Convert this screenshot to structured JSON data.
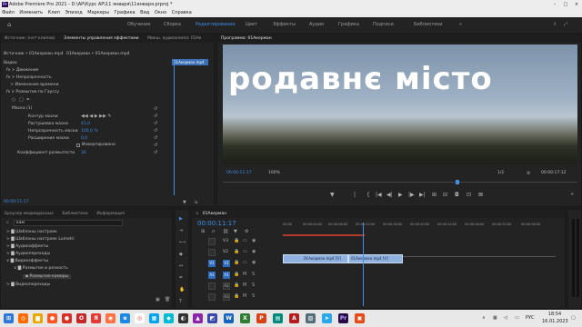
{
  "titlebar": {
    "title": "Adobe Premiere Pro 2021 - D:\\AP\\Курс AP\\11 января\\11января.prproj *",
    "logo": "Pr"
  },
  "menu": [
    "Файл",
    "Изменить",
    "Клип",
    "Эпизод",
    "Маркеры",
    "Графика",
    "Вид",
    "Окно",
    "Справка"
  ],
  "workspaces": [
    "Обучение",
    "Сборка",
    "Редактирование",
    "Цвет",
    "Эффекты",
    "Аудио",
    "Графика",
    "Подписи",
    "Библиотеки"
  ],
  "effect_controls": {
    "tabs": [
      "Источник: (нет клипов)",
      "Элементы управления эффектами",
      "Микш. аудиоклипа: 01Ак"
    ],
    "source_line": "Источник • 01Акерман.mp4",
    "sequence_line": "01Акерман • 01Акерман.mp4",
    "clip_label": "01Акерман.mp4",
    "video_header": "Видео",
    "rows": [
      "Движение",
      "Непрозрачность",
      "Изменение времени",
      "Размытие по Гауссу"
    ],
    "mask": "Маска (1)",
    "mask_path": "Контур маски",
    "mask_feather": "Растушевка маски",
    "mask_feather_value": "41,0",
    "mask_opacity": "Непрозрачность маски",
    "mask_opacity_value": "100,0 %",
    "mask_expansion": "Расширение маски",
    "mask_expansion_value": "0,0",
    "inverted": "Инвертировано",
    "blurriness": "Коэффициент размытости",
    "blurriness_value": "30",
    "timecode": "00:00:11:17"
  },
  "program": {
    "tab": "Программа: 01Акерман",
    "overlay_text": "родавнє місто",
    "timecode": "00:00:11:17",
    "zoom": "100%",
    "resolution": "1/2",
    "duration": "00:00:17:12"
  },
  "project": {
    "tabs": [
      "Браузер медиаданных",
      "Библиотеки",
      "Информация"
    ],
    "search": "кам",
    "items": [
      "Шаблоны настроек",
      "Шаблоны настроек Lumetri",
      "Аудиоэффекты",
      "Аудиопереходы",
      "Видеоэффекты",
      "Размытие и резкость",
      "Размытие камеры",
      "Видеопереходы"
    ]
  },
  "timeline": {
    "tab": "01Акерман",
    "timecode": "00:00:11:17",
    "ruler": [
      "00:00",
      "00:00:04:00",
      "00:00:08:00",
      "00:00:12:00",
      "00:00:16:00",
      "00:00:20:00",
      "00:00:24:00",
      "00:00:28:00",
      "00:00:32:00",
      "00:00:36:00"
    ],
    "video_tracks": [
      "V3",
      "V2",
      "V1"
    ],
    "audio_tracks": [
      "A1",
      "A2",
      "A3"
    ],
    "clip1": "01Акерман.mp4 [V]",
    "clip2": "01Акерман.mp4 [V]"
  },
  "taskbar": {
    "lang": "РУС",
    "time": "18:54",
    "date": "16.01.2023"
  },
  "colors": {
    "accent": "#3d8fe8",
    "clip": "#8fb2e0",
    "bg": "#1d1d1d"
  }
}
